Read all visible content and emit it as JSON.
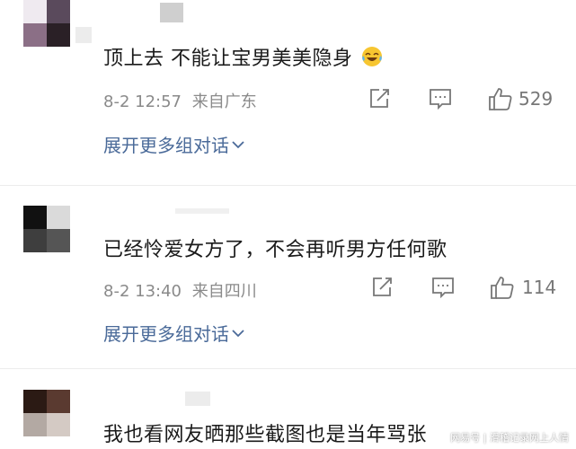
{
  "comments": [
    {
      "text": "顶上去 不能让宝男美美隐身",
      "emoji": "laughing-tears-emoji",
      "timestamp": "8-2 12:57",
      "location": "来自广东",
      "likes": "529",
      "expand_label": "展开更多组对话"
    },
    {
      "text": "已经怜爱女方了，不会再听男方任何歌",
      "timestamp": "8-2 13:40",
      "location": "来自四川",
      "likes": "114",
      "expand_label": "展开更多组对话"
    },
    {
      "text": "我也看网友晒那些截图也是当年骂张"
    }
  ],
  "watermark": "网易号 | 滑稽记录网上人情",
  "icons": [
    "share-icon",
    "comment-icon",
    "like-icon",
    "chevron-down-icon"
  ],
  "colors": {
    "link": "#4a6a99",
    "meta": "#8a8a8a",
    "text": "#1a1a1a",
    "icon": "#777777"
  }
}
